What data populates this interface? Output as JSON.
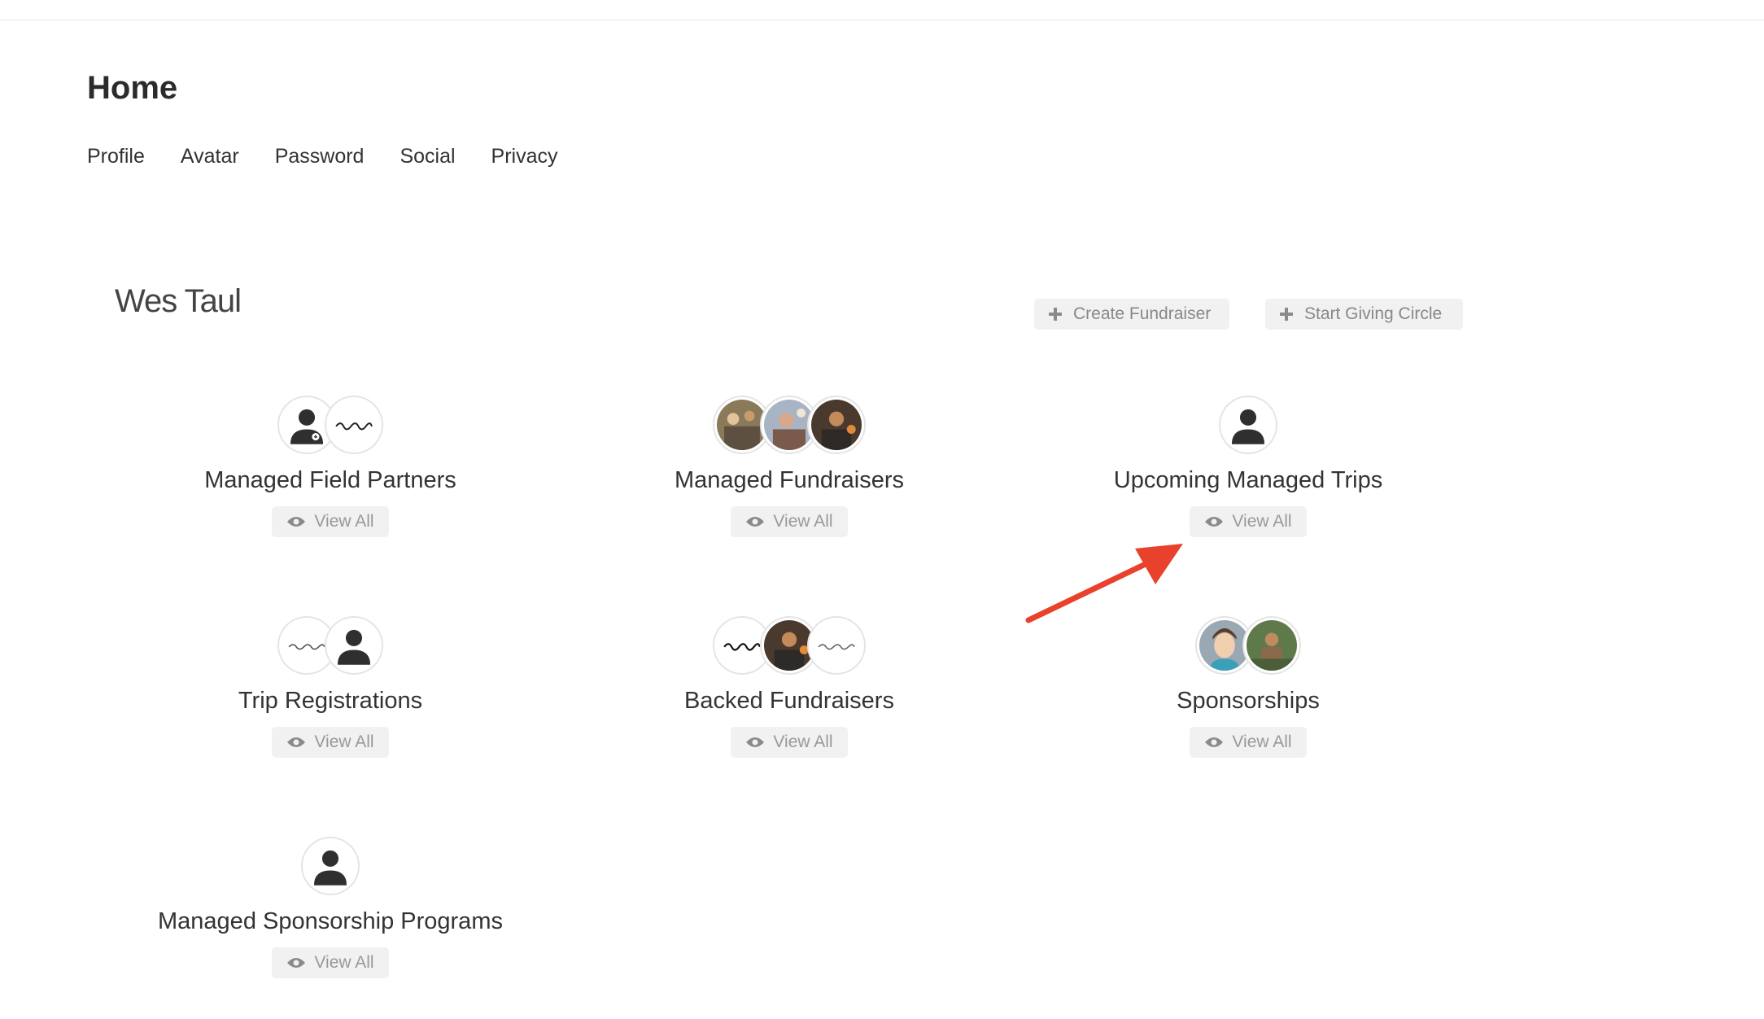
{
  "page": {
    "title": "Home"
  },
  "nav": {
    "items": [
      "Profile",
      "Avatar",
      "Password",
      "Social",
      "Privacy"
    ]
  },
  "user": {
    "name": "Wes Taul"
  },
  "actions": {
    "create_fundraiser": "Create Fundraiser",
    "start_giving_circle": "Start Giving Circle"
  },
  "cards": [
    {
      "title": "Managed Field Partners",
      "view_label": "View All",
      "avatars": [
        "person-plus-icon",
        "choose-hope-logo"
      ]
    },
    {
      "title": "Managed Fundraisers",
      "view_label": "View All",
      "avatars": [
        "photo",
        "photo",
        "photo"
      ]
    },
    {
      "title": "Upcoming Managed Trips",
      "view_label": "View All",
      "avatars": [
        "person-icon"
      ]
    },
    {
      "title": "Trip Registrations",
      "view_label": "View All",
      "avatars": [
        "choose-hope-logo",
        "person-icon"
      ]
    },
    {
      "title": "Backed Fundraisers",
      "view_label": "View All",
      "avatars": [
        "choose-hope-logo",
        "photo",
        "choose-hope-logo"
      ]
    },
    {
      "title": "Sponsorships",
      "view_label": "View All",
      "avatars": [
        "face-illustration",
        "photo"
      ]
    },
    {
      "title": "Managed Sponsorship Programs",
      "view_label": "View All",
      "avatars": [
        "person-icon"
      ]
    }
  ],
  "colors": {
    "annotation_arrow": "#e8412c",
    "button_bg": "#f1f1f1",
    "button_text": "#999999"
  }
}
